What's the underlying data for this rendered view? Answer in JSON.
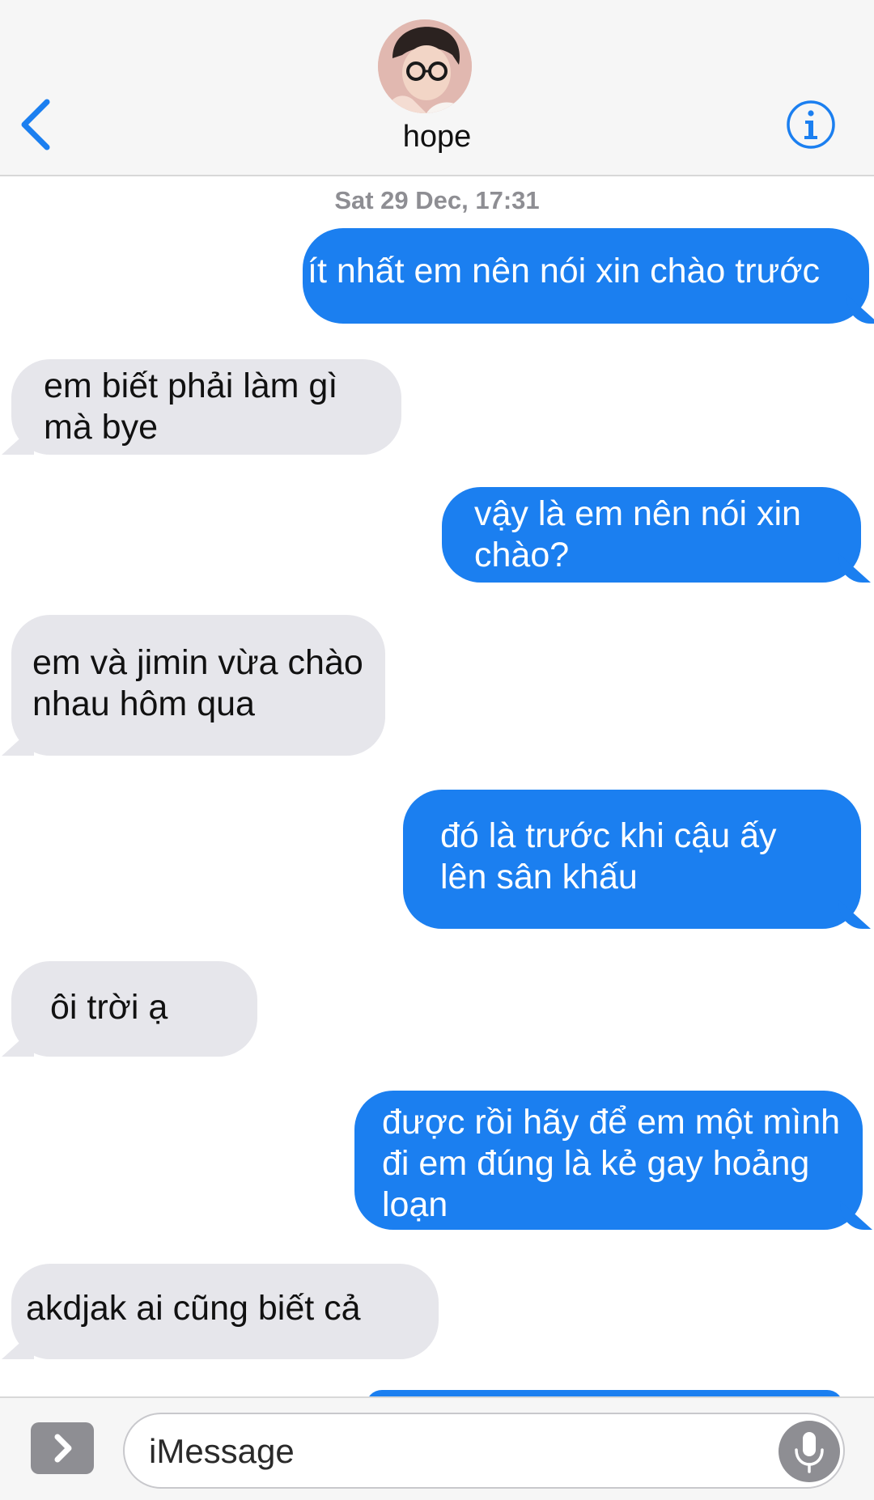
{
  "header": {
    "contact_name": "hope"
  },
  "chat": {
    "timestamp": "Sat 29 Dec, 17:31",
    "messages": [
      {
        "direction": "sent",
        "text": "ít nhất em nên nói xin chào trước"
      },
      {
        "direction": "received",
        "text": "em biết phải làm gì\nmà bye"
      },
      {
        "direction": "sent",
        "text": "vậy là em nên nói xin\nchào?"
      },
      {
        "direction": "received",
        "text": "em và jimin vừa chào\nnhau hôm qua"
      },
      {
        "direction": "sent",
        "text": "đó là trước khi cậu ấy\nlên sân khấu"
      },
      {
        "direction": "received",
        "text": "ôi trời ạ"
      },
      {
        "direction": "sent",
        "text": "được rồi hãy để em một mình\nđi em đúng là kẻ gay hoảng\nloạn"
      },
      {
        "direction": "received",
        "text": "akdjak ai cũng biết cả"
      }
    ]
  },
  "input_bar": {
    "placeholder": "iMessage"
  },
  "icons": {
    "back": "chevron-left-icon",
    "info": "info-icon",
    "apps": "chevron-right-icon",
    "mic": "microphone-icon"
  },
  "colors": {
    "accent": "#1b7ff0",
    "sent_bubble": "#1b7ff0",
    "received_bubble": "#e6e6eb",
    "timestamp": "#8e8e93"
  }
}
